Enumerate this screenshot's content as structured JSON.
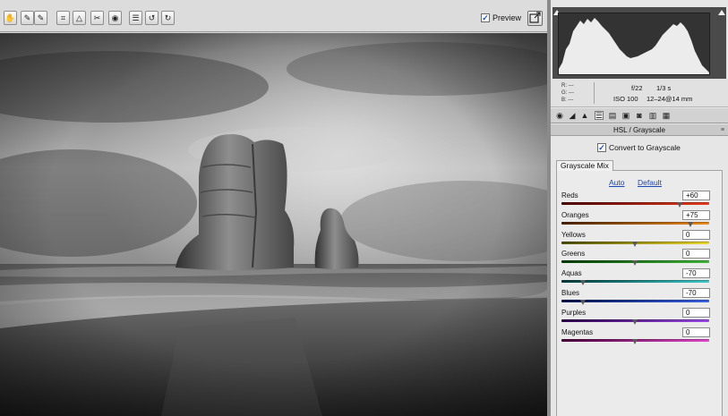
{
  "toolbar": {
    "tools": [
      {
        "icon": "hand-icon",
        "glyph": "✋"
      },
      {
        "icon": "eyedropper-icon",
        "glyph": "✎"
      },
      {
        "icon": "color-sampler-icon",
        "glyph": "✎"
      },
      {
        "icon": "crop-icon",
        "glyph": "⌗"
      },
      {
        "icon": "straighten-icon",
        "glyph": "△"
      },
      {
        "icon": "spot-removal-icon",
        "glyph": "✂"
      },
      {
        "icon": "red-eye-icon",
        "glyph": "◉"
      },
      {
        "icon": "preferences-icon",
        "glyph": "☰"
      },
      {
        "icon": "rotate-left-icon",
        "glyph": "↺"
      },
      {
        "icon": "rotate-right-icon",
        "glyph": "↻"
      }
    ],
    "preview_checked": true,
    "preview_label": "Preview"
  },
  "info": {
    "r_label": "R:",
    "g_label": "G:",
    "b_label": "B:",
    "r_value": "---",
    "g_value": "---",
    "b_value": "---",
    "aperture": "f/22",
    "shutter": "1/3 s",
    "iso": "ISO 100",
    "lens": "12–24@14 mm"
  },
  "panel": {
    "section_title": "HSL / Grayscale",
    "convert_checked": true,
    "convert_label": "Convert to Grayscale",
    "subtab_label": "Grayscale Mix",
    "auto_link": "Auto",
    "default_link": "Default",
    "sliders": [
      {
        "label": "Reds",
        "value": "+60",
        "fraction": 0.8,
        "colors": [
          "#4a0000",
          "#e83c1e"
        ]
      },
      {
        "label": "Oranges",
        "value": "+75",
        "fraction": 0.875,
        "colors": [
          "#4a2200",
          "#ec8a1c"
        ]
      },
      {
        "label": "Yellows",
        "value": "0",
        "fraction": 0.5,
        "colors": [
          "#4a4a00",
          "#ecd82a"
        ]
      },
      {
        "label": "Greens",
        "value": "0",
        "fraction": 0.5,
        "colors": [
          "#003a00",
          "#3fb83a"
        ]
      },
      {
        "label": "Aquas",
        "value": "-70",
        "fraction": 0.15,
        "colors": [
          "#003a3a",
          "#3cc8c8"
        ]
      },
      {
        "label": "Blues",
        "value": "-70",
        "fraction": 0.15,
        "colors": [
          "#00104a",
          "#3860e6"
        ]
      },
      {
        "label": "Purples",
        "value": "0",
        "fraction": 0.5,
        "colors": [
          "#2a0048",
          "#9a48e6"
        ]
      },
      {
        "label": "Magentas",
        "value": "0",
        "fraction": 0.5,
        "colors": [
          "#48003a",
          "#e048c8"
        ]
      }
    ]
  }
}
